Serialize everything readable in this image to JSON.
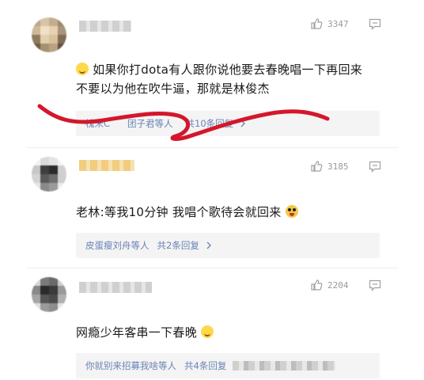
{
  "comments": [
    {
      "likes": "3347",
      "text_line1": "如果你打dota有人跟你说他要去春晚唱一下再回来",
      "text_line2": "不要以为他在吹牛逼，那就是林俊杰",
      "reply_users": "槐米C",
      "reply_users_cont": "团子君等人",
      "reply_count": "共10条回复",
      "emoji": "smiling-face-emoji"
    },
    {
      "likes": "3185",
      "text": "老林:等我10分钟  我唱个歌待会就回来",
      "reply_users": "皮蛋瘦刘舟等人",
      "reply_count": "共2条回复",
      "emoji": "crazy-face-emoji"
    },
    {
      "likes": "2204",
      "text": "网瘾少年客串一下春晚",
      "reply_users": "你就别来招募我啥等人",
      "reply_count": "共4条回复",
      "emoji": "smiling-face-emoji"
    }
  ],
  "colors": {
    "annotation_stroke": "#d4172b",
    "reply_link": "#6a83b5",
    "likes_text": "#9a9a9a"
  },
  "icons": [
    "thumbs-up-icon",
    "comment-icon",
    "chevron-right-icon"
  ]
}
